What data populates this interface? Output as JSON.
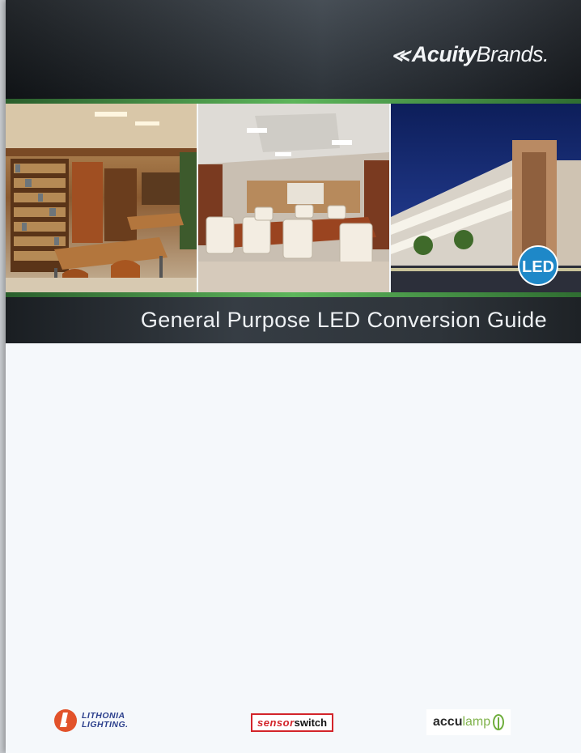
{
  "header": {
    "brand_prefix": "Acuity",
    "brand_suffix": "Brands."
  },
  "photos": {
    "led_badge": "LED"
  },
  "document": {
    "title": "General Purpose LED Conversion Guide"
  },
  "footer": {
    "lithonia_line1": "LITHONIA",
    "lithonia_line2": "LIGHTING.",
    "sensor_part1": "sensor",
    "sensor_part2": "switch",
    "acculamp_part1": "accu",
    "acculamp_part2": "lamp"
  },
  "colors": {
    "accent_green": "#5db55b",
    "lithonia_orange": "#e2522a",
    "lithonia_blue": "#2b3f8c",
    "sensor_red": "#d3242a",
    "acculamp_green": "#7fb24a",
    "led_badge_blue": "#1e88c8"
  }
}
